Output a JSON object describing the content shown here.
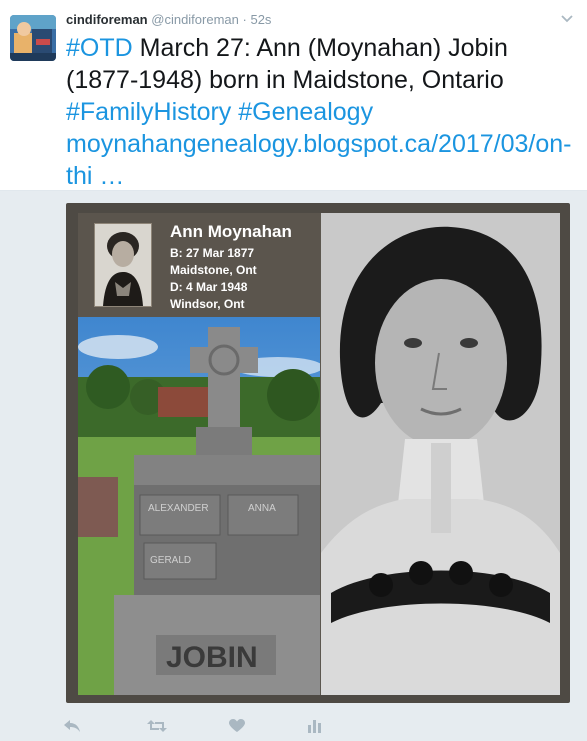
{
  "tweet": {
    "name": "cindiforeman",
    "handle": "@cindiforeman",
    "separator": "·",
    "time": "52s",
    "text_parts": {
      "tag_otd": "#OTD",
      "main": " March 27: Ann (Moynahan) Jobin (1877-1948) born in Maidstone, Ontario ",
      "tag_family": "#FamilyHistory",
      "tag_genealogy": "#Genealogy",
      "link": "moynahangenealogy.blogspot.ca/2017/03/on-thi …"
    }
  },
  "media": {
    "info": {
      "name": "Ann Moynahan",
      "birth": "B: 27 Mar 1877",
      "birth_place": "Maidstone, Ont",
      "death": "D: 4 Mar 1948",
      "death_place": "Windsor, Ont"
    },
    "headstone": {
      "surname": "JOBIN",
      "left_name": "ALEXANDER",
      "right_name": "ANNA",
      "lower_name": "GERALD"
    }
  },
  "icons": {
    "caret": "chevron-down-icon",
    "reply": "reply-icon",
    "retweet": "retweet-icon",
    "like": "heart-icon",
    "analytics": "analytics-icon"
  },
  "colors": {
    "link": "#1b95e0",
    "icon": "#aab8c2",
    "frame": "#4e4a44"
  }
}
